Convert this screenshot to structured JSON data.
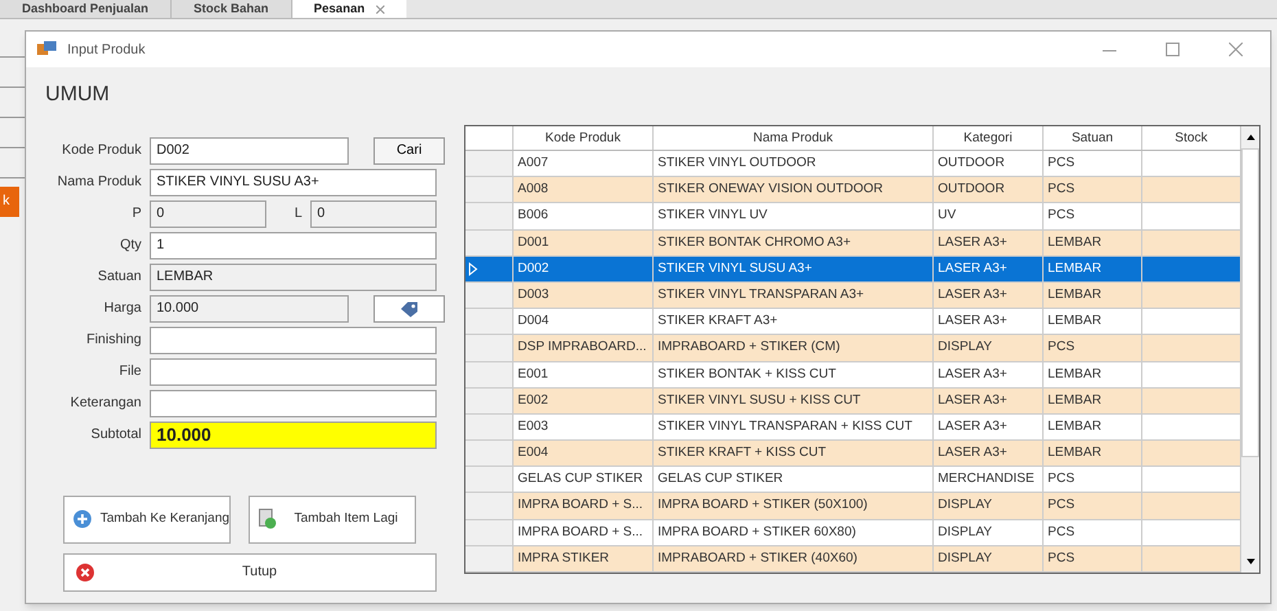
{
  "background_tabs": [
    {
      "label": "Dashboard Penjualan",
      "selected": false
    },
    {
      "label": "Stock Bahan",
      "selected": false
    },
    {
      "label": "Pesanan",
      "selected": true,
      "closable": true
    }
  ],
  "background_button": {
    "label": "k"
  },
  "window": {
    "title": "Input Produk"
  },
  "section_title": "UMUM",
  "form": [
    {
      "kind": "search",
      "label": "Kode Produk",
      "value": "D002",
      "disabled": false,
      "button": "Cari"
    },
    {
      "kind": "text",
      "label": "Nama Produk",
      "value": "STIKER VINYL SUSU A3+",
      "disabled": false
    },
    {
      "kind": "pair",
      "label": "P",
      "value": "0",
      "disabled": true,
      "label2": "L",
      "value2": "0"
    },
    {
      "kind": "text",
      "label": "Qty",
      "value": "1",
      "disabled": false
    },
    {
      "kind": "text",
      "label": "Satuan",
      "value": "LEMBAR",
      "disabled": true
    },
    {
      "kind": "price",
      "label": "Harga",
      "value": "10.000",
      "disabled": true
    },
    {
      "kind": "text",
      "label": "Finishing",
      "disabled": false
    },
    {
      "kind": "text",
      "label": "File",
      "disabled": false
    },
    {
      "kind": "text",
      "label": "Keterangan",
      "disabled": false
    },
    {
      "kind": "total",
      "label": "Subtotal",
      "value": "10.000"
    }
  ],
  "buttons": [
    {
      "kind": "add",
      "label": "Tambah Ke Keranjang"
    },
    {
      "kind": "new",
      "label": "Tambah Item Lagi"
    },
    {
      "kind": "close",
      "label": "Tutup"
    }
  ],
  "table": {
    "columns": [
      "Kode Produk",
      "Nama Produk",
      "Kategori",
      "Satuan",
      "Stock"
    ],
    "rows": [
      {
        "cells": [
          "A007",
          "STIKER VINYL OUTDOOR",
          "OUTDOOR",
          "PCS",
          ""
        ],
        "selected": false
      },
      {
        "cells": [
          "A008",
          "STIKER ONEWAY VISION OUTDOOR",
          "OUTDOOR",
          "PCS",
          ""
        ],
        "selected": false
      },
      {
        "cells": [
          "B006",
          "STIKER VINYL UV",
          "UV",
          "PCS",
          ""
        ],
        "selected": false
      },
      {
        "cells": [
          "D001",
          "STIKER BONTAK CHROMO A3+",
          "LASER A3+",
          "LEMBAR",
          ""
        ],
        "selected": false
      },
      {
        "cells": [
          "D002",
          "STIKER VINYL SUSU A3+",
          "LASER A3+",
          "LEMBAR",
          ""
        ],
        "selected": true
      },
      {
        "cells": [
          "D003",
          "STIKER VINYL TRANSPARAN A3+",
          "LASER A3+",
          "LEMBAR",
          ""
        ],
        "selected": false
      },
      {
        "cells": [
          "D004",
          "STIKER KRAFT A3+",
          "LASER A3+",
          "LEMBAR",
          ""
        ],
        "selected": false
      },
      {
        "cells": [
          "DSP IMPRABOARD...",
          "IMPRABOARD + STIKER (CM)",
          "DISPLAY",
          "PCS",
          ""
        ],
        "selected": false
      },
      {
        "cells": [
          "E001",
          "STIKER BONTAK + KISS CUT",
          "LASER A3+",
          "LEMBAR",
          ""
        ],
        "selected": false
      },
      {
        "cells": [
          "E002",
          "STIKER VINYL SUSU + KISS CUT",
          "LASER A3+",
          "LEMBAR",
          ""
        ],
        "selected": false
      },
      {
        "cells": [
          "E003",
          "STIKER VINYL TRANSPARAN + KISS CUT",
          "LASER A3+",
          "LEMBAR",
          ""
        ],
        "selected": false
      },
      {
        "cells": [
          "E004",
          "STIKER KRAFT + KISS CUT",
          "LASER A3+",
          "LEMBAR",
          ""
        ],
        "selected": false
      },
      {
        "cells": [
          "GELAS CUP STIKER",
          "GELAS CUP STIKER",
          "MERCHANDISE",
          "PCS",
          ""
        ],
        "selected": false
      },
      {
        "cells": [
          "IMPRA BOARD + S...",
          "IMPRA BOARD + STIKER (50X100)",
          "DISPLAY",
          "PCS",
          ""
        ],
        "selected": false
      },
      {
        "cells": [
          "IMPRA BOARD + S...",
          "IMPRA BOARD + STIKER 60X80)",
          "DISPLAY",
          "PCS",
          ""
        ],
        "selected": false
      },
      {
        "cells": [
          "IMPRA STIKER",
          "IMPRABOARD + STIKER (40X60)",
          "DISPLAY",
          "PCS",
          ""
        ],
        "selected": false
      }
    ]
  }
}
